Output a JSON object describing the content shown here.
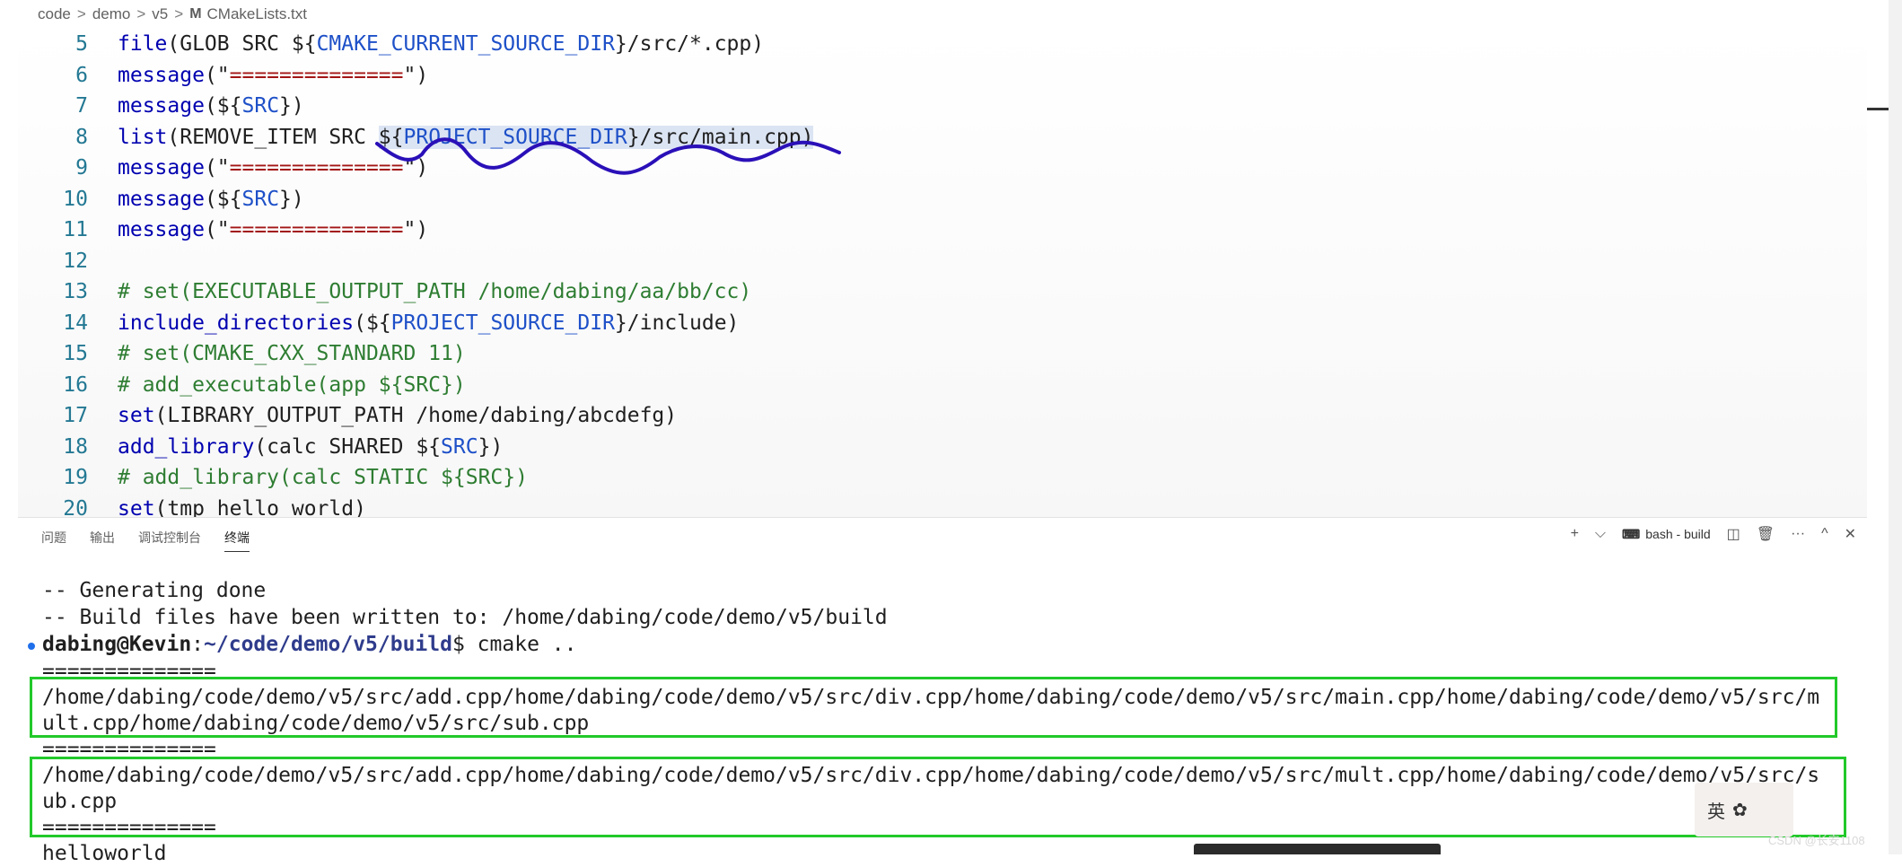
{
  "breadcrumb": {
    "items": [
      "code",
      "demo",
      "v5"
    ],
    "badge": "M",
    "file": "CMakeLists.txt"
  },
  "editor": {
    "lines": [
      {
        "n": "5",
        "segs": [
          [
            "kw",
            "file"
          ],
          [
            "",
            "(GLOB SRC "
          ],
          [
            "dol",
            "${"
          ],
          [
            "var",
            "CMAKE_CURRENT_SOURCE_DIR"
          ],
          [
            "dol",
            "}"
          ],
          [
            "",
            "/src/*.cpp)"
          ]
        ]
      },
      {
        "n": "6",
        "segs": [
          [
            "kw",
            "message"
          ],
          [
            "",
            "(\""
          ],
          [
            "str",
            "=============="
          ],
          [
            "",
            "\")"
          ]
        ]
      },
      {
        "n": "7",
        "segs": [
          [
            "kw",
            "message"
          ],
          [
            "",
            "("
          ],
          [
            "dol",
            "${"
          ],
          [
            "var",
            "SRC"
          ],
          [
            "dol",
            "}"
          ],
          [
            "",
            ")"
          ]
        ]
      },
      {
        "n": "8",
        "segs": [
          [
            "kw",
            "list"
          ],
          [
            "",
            "(REMOVE_ITEM SRC "
          ],
          [
            "dol",
            "${"
          ],
          [
            "var",
            "PROJECT_SOURCE_DIR"
          ],
          [
            "dol",
            "}"
          ],
          [
            "",
            "/src/main.cpp)"
          ]
        ],
        "selected": true
      },
      {
        "n": "9",
        "segs": [
          [
            "kw",
            "message"
          ],
          [
            "",
            "(\""
          ],
          [
            "str",
            "=============="
          ],
          [
            "",
            "\")"
          ]
        ]
      },
      {
        "n": "10",
        "segs": [
          [
            "kw",
            "message"
          ],
          [
            "",
            "("
          ],
          [
            "dol",
            "${"
          ],
          [
            "var",
            "SRC"
          ],
          [
            "dol",
            "}"
          ],
          [
            "",
            ")"
          ]
        ]
      },
      {
        "n": "11",
        "segs": [
          [
            "kw",
            "message"
          ],
          [
            "",
            "(\""
          ],
          [
            "str",
            "=============="
          ],
          [
            "",
            "\")"
          ]
        ]
      },
      {
        "n": "12",
        "segs": []
      },
      {
        "n": "13",
        "segs": [
          [
            "cmt",
            "# set(EXECUTABLE_OUTPUT_PATH /home/dabing/aa/bb/cc)"
          ]
        ]
      },
      {
        "n": "14",
        "segs": [
          [
            "kw",
            "include_directories"
          ],
          [
            "",
            "("
          ],
          [
            "dol",
            "${"
          ],
          [
            "var",
            "PROJECT_SOURCE_DIR"
          ],
          [
            "dol",
            "}"
          ],
          [
            "",
            "/include)"
          ]
        ]
      },
      {
        "n": "15",
        "segs": [
          [
            "cmt",
            "# set(CMAKE_CXX_STANDARD 11)"
          ]
        ]
      },
      {
        "n": "16",
        "segs": [
          [
            "cmt",
            "# add_executable(app ${SRC})"
          ]
        ]
      },
      {
        "n": "17",
        "segs": [
          [
            "kw",
            "set"
          ],
          [
            "",
            "(LIBRARY_OUTPUT_PATH /home/dabing/abcdefg)"
          ]
        ]
      },
      {
        "n": "18",
        "segs": [
          [
            "kw",
            "add_library"
          ],
          [
            "",
            "(calc SHARED "
          ],
          [
            "dol",
            "${"
          ],
          [
            "var",
            "SRC"
          ],
          [
            "dol",
            "}"
          ],
          [
            "",
            ")"
          ]
        ]
      },
      {
        "n": "19",
        "segs": [
          [
            "cmt",
            "# add_library(calc STATIC ${SRC})"
          ]
        ]
      },
      {
        "n": "20",
        "segs": [
          [
            "kw",
            "set"
          ],
          [
            "",
            "(tmp hello world)"
          ]
        ]
      }
    ]
  },
  "panel": {
    "tabs": [
      "问题",
      "输出",
      "调试控制台",
      "终端"
    ],
    "active_tab": 3,
    "terminal_name": "bash - build",
    "actions": {
      "add": "+",
      "dropdown": "⌵",
      "split": "◫",
      "trash": "🗑",
      "more": "···",
      "maximize": "^",
      "close": "✕"
    }
  },
  "terminal": {
    "line1": "-- Generating done",
    "line2": "-- Build files have been written to: /home/dabing/code/demo/v5/build",
    "prompt_user": "dabing@Kevin",
    "prompt_colon": ":",
    "prompt_path": "~/code/demo/v5/build",
    "prompt_cmd": "$ cmake ..",
    "sep1": "==============",
    "out1a": "/home/dabing/code/demo/v5/src/add.cpp/home/dabing/code/demo/v5/src/div.cpp/home/dabing/code/demo/v5/src/main.cpp/home/dabing/code/demo/v5/src/m",
    "out1b": "ult.cpp/home/dabing/code/demo/v5/src/sub.cpp",
    "sep2": "==============",
    "out2a": "/home/dabing/code/demo/v5/src/add.cpp/home/dabing/code/demo/v5/src/div.cpp/home/dabing/code/demo/v5/src/mult.cpp/home/dabing/code/demo/v5/src/s",
    "out2b": "ub.cpp",
    "sep3": "==============",
    "last": "helloworld"
  },
  "ime": {
    "label": "英"
  },
  "watermark": "CSDN @长安1108",
  "colors": {
    "annotation_box": "#22c92a",
    "scribble": "#2a10b8"
  }
}
